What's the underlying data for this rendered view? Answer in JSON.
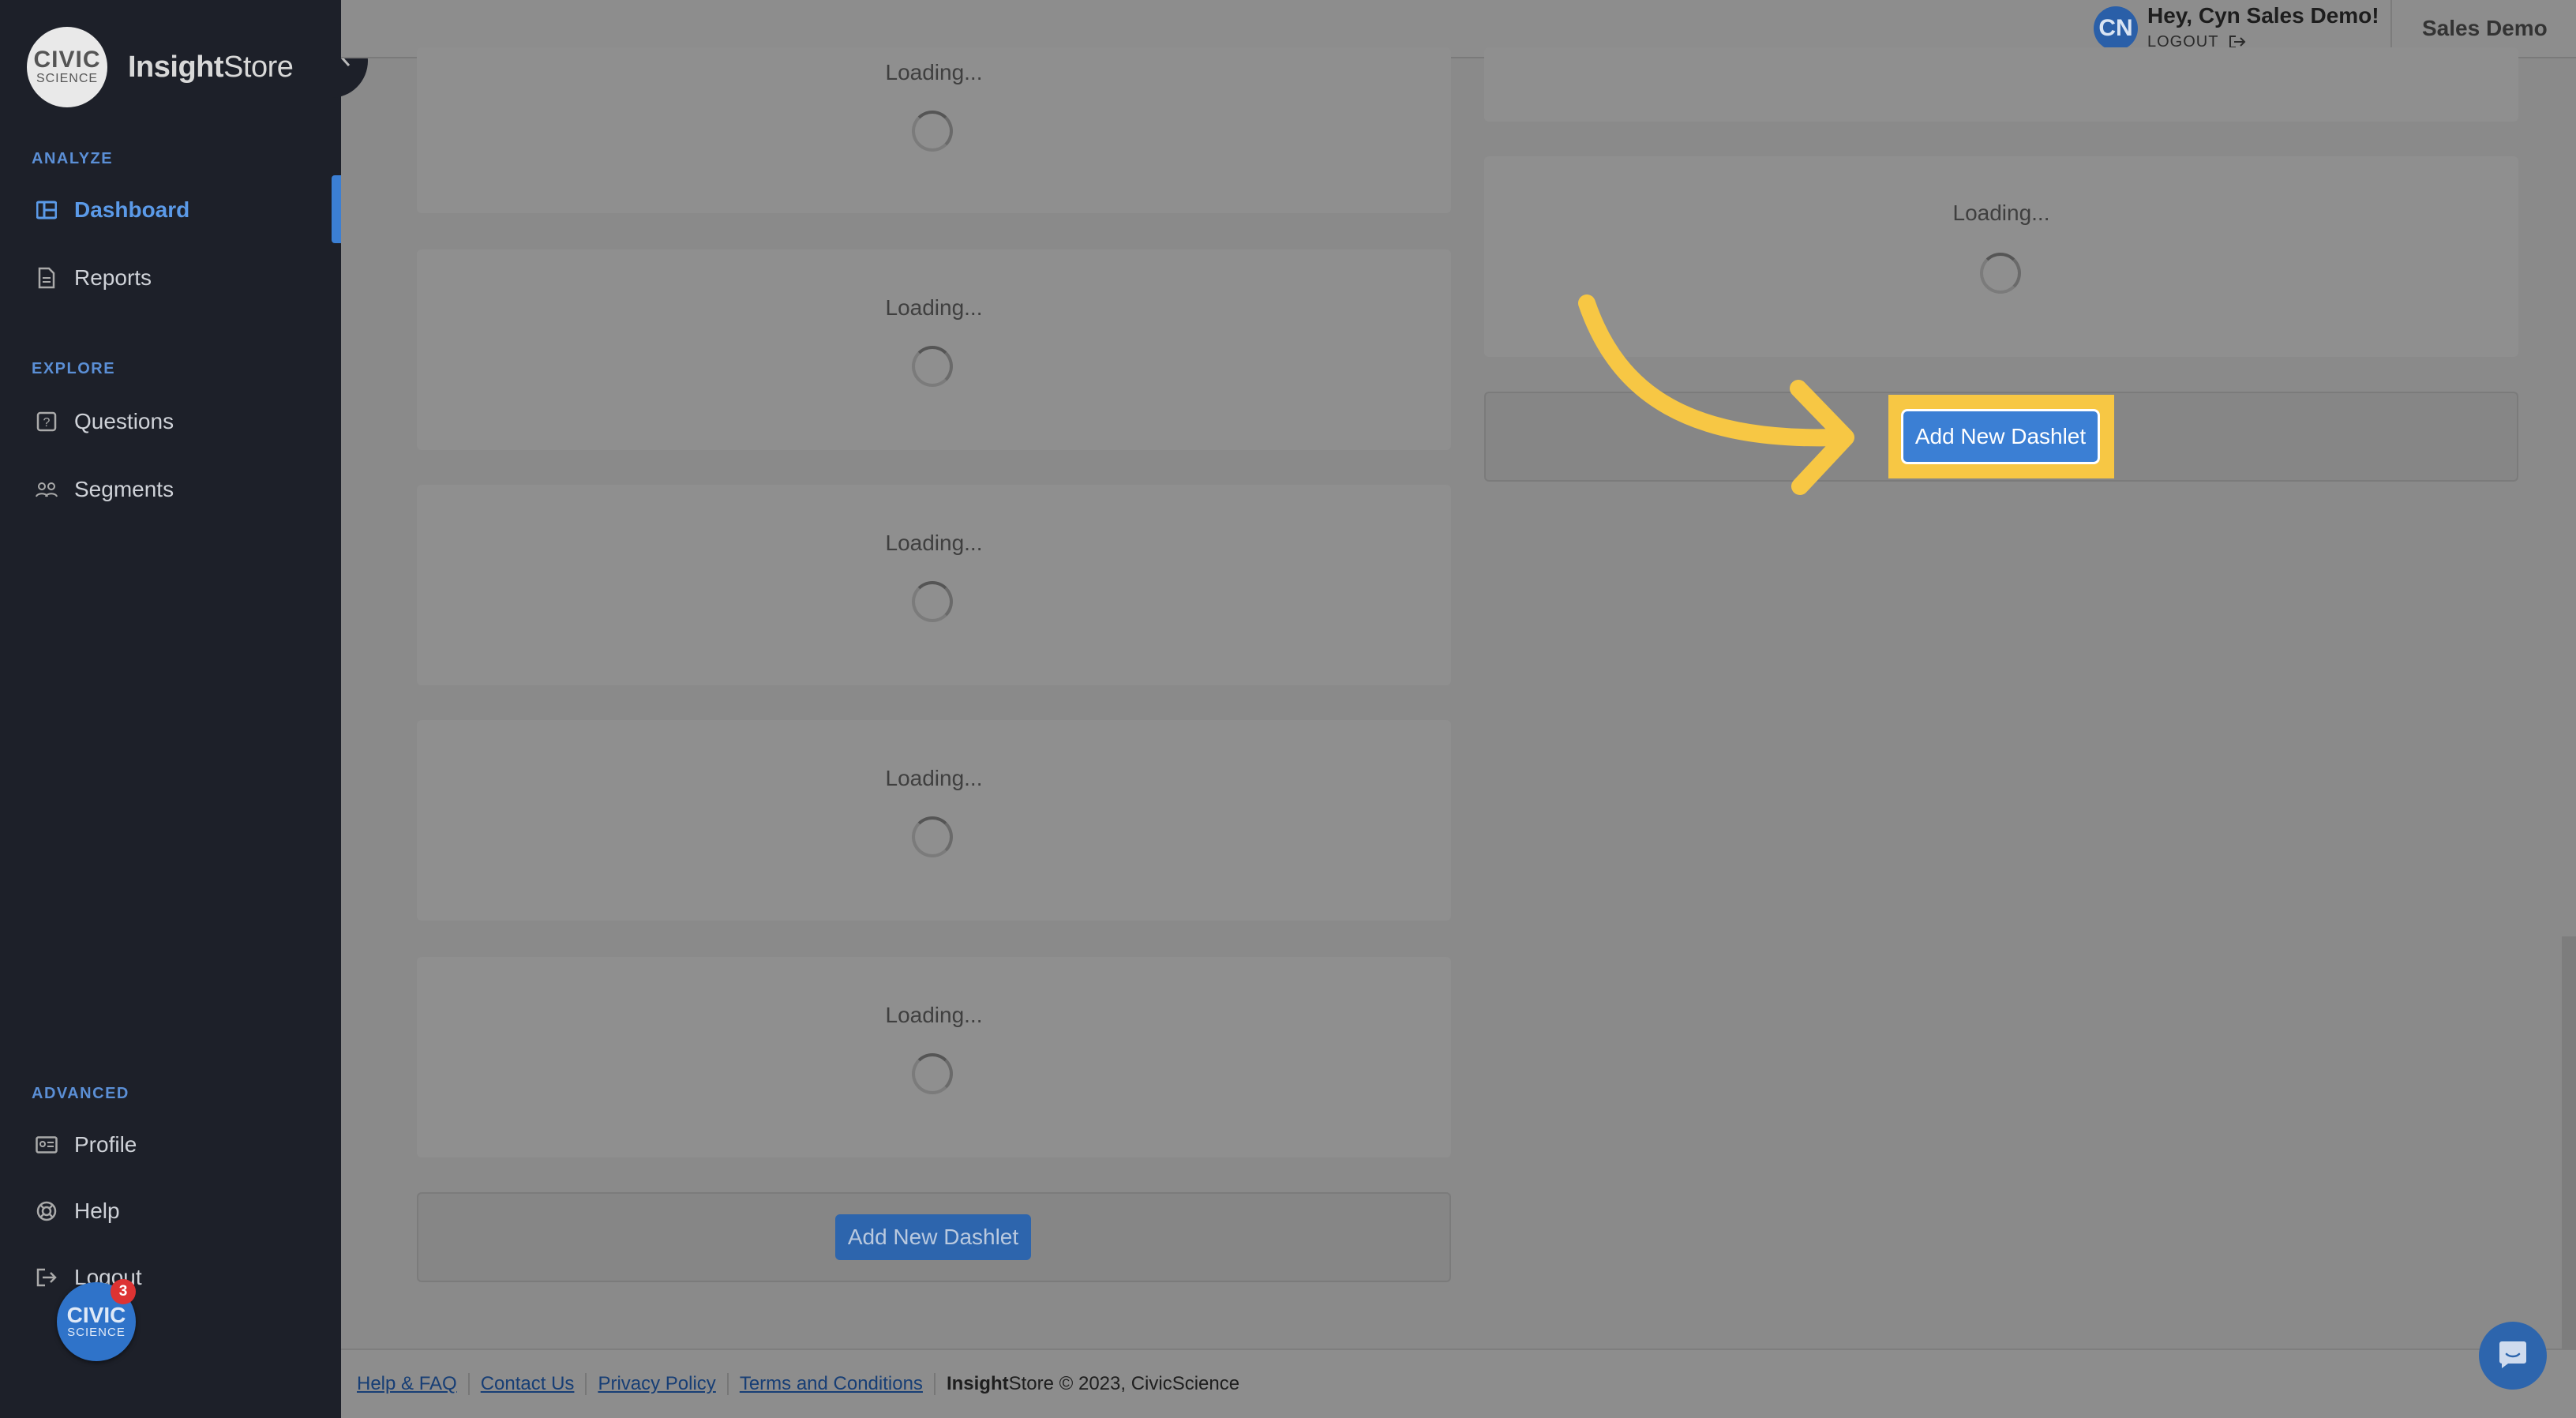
{
  "brand": {
    "logo_line1": "CIVIC",
    "logo_line2": "SCIENCE",
    "name_bold": "Insight",
    "name_rest": "Store"
  },
  "sidebar": {
    "sections": [
      {
        "label": "ANALYZE"
      },
      {
        "label": "EXPLORE"
      },
      {
        "label": "ADVANCED"
      }
    ],
    "items": [
      {
        "label": "Dashboard",
        "icon": "dashboard-icon",
        "active": true
      },
      {
        "label": "Reports",
        "icon": "document-icon"
      },
      {
        "label": "Questions",
        "icon": "question-icon"
      },
      {
        "label": "Segments",
        "icon": "people-icon"
      },
      {
        "label": "Profile",
        "icon": "id-card-icon"
      },
      {
        "label": "Help",
        "icon": "lifebuoy-icon"
      },
      {
        "label": "Logout",
        "icon": "logout-icon"
      }
    ],
    "badge": {
      "line1": "CIVIC",
      "line2": "SCIENCE",
      "count": "3"
    }
  },
  "topbar": {
    "avatar_initials": "CN",
    "greeting": "Hey, Cyn Sales Demo!",
    "logout_label": "LOGOUT",
    "account_name": "Sales Demo"
  },
  "main": {
    "loading_text": "Loading...",
    "add_dashlet_label": "Add New Dashlet"
  },
  "footer": {
    "links": [
      "Help & FAQ",
      "Contact Us",
      "Privacy Policy",
      "Terms and Conditions"
    ],
    "copyright_bold": "Insight",
    "copyright_rest": "Store © 2023, CivicScience"
  },
  "colors": {
    "sidebar_bg": "#1d2029",
    "accent": "#3b7fd4",
    "highlight": "#f7c744"
  }
}
